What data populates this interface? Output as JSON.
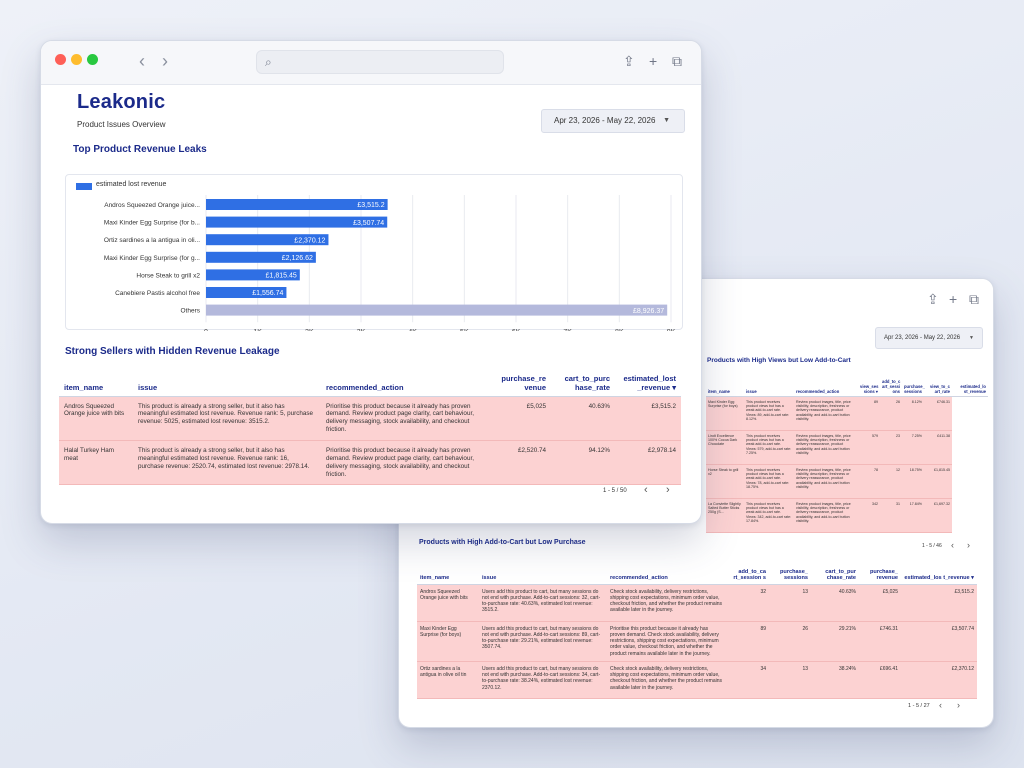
{
  "main": {
    "brand": "Leakonic",
    "subtitle": "Product Issues Overview",
    "date_range": "Apr 23, 2026 - May 22, 2026",
    "chart_title": "Top Product Revenue Leaks",
    "section2_title": "Strong Sellers with Hidden Revenue Leakage",
    "table": {
      "headers": [
        "item_name",
        "issue",
        "recommended_action",
        "purchase_re venue",
        "cart_to_purc hase_rate",
        "estimated_lost _revenue ▾"
      ],
      "rows": [
        [
          "Andros Squeezed Orange juice with bits",
          "This product is already a strong seller, but it also has meaningful estimated lost revenue. Revenue rank: 5, purchase revenue: 5025, estimated lost revenue: 3515.2.",
          "Prioritise this product because it already has proven demand. Review product page clarity, cart behaviour, delivery messaging, stock availability, and checkout friction.",
          "£5,025",
          "40.63%",
          "£3,515.2"
        ],
        [
          "Halal Turkey Ham meat",
          "This product is already a strong seller, but it also has meaningful estimated lost revenue. Revenue rank: 16, purchase revenue: 2520.74, estimated lost revenue: 2978.14.",
          "Prioritise this product because it already has proven demand. Review product page clarity, cart behaviour, delivery messaging, stock availability, and checkout friction.",
          "£2,520.74",
          "94.12%",
          "£2,978.14"
        ]
      ],
      "pager": "1 - 5 / 50"
    }
  },
  "chart_data": {
    "type": "bar",
    "orientation": "horizontal",
    "legend": "estimated lost revenue",
    "categories": [
      "Andros Squeezed Orange juice...",
      "Maxi Kinder Egg Surprise (for b...",
      "Ortiz sardines a la antigua in oli...",
      "Maxi Kinder Egg Surprise (for g...",
      "Horse Steak to grill x2",
      "Canebiere Pastis alcohol free",
      "Others"
    ],
    "values": [
      3515.2,
      3507.74,
      2370.12,
      2126.62,
      1815.45,
      1556.74,
      8926.37
    ],
    "value_labels": [
      "£3,515.2",
      "£3,507.74",
      "£2,370.12",
      "£2,126.62",
      "£1,815.45",
      "£1,556.74",
      "£8,926.37"
    ],
    "xlim": [
      0,
      9000
    ],
    "x_ticks": [
      "0",
      "1K",
      "2K",
      "3K",
      "4K",
      "5K",
      "6K",
      "7K",
      "8K",
      "9K"
    ],
    "grid": true,
    "colors": {
      "bar": "#2f6fe4",
      "others": "#b4b9dc"
    }
  },
  "second": {
    "date_range": "Apr 23, 2026 - May 22, 2026",
    "section1_title": "Products with High Views but Low Add-to-Cart",
    "table1": {
      "headers": [
        "item_name",
        "issue",
        "recommended_action",
        "view_ses sions ▾",
        "add_to_c art_sessi ons",
        "purchase_ sessions",
        "view_to_c art_rate",
        "estimated_lo st_revenue"
      ],
      "rows": [
        [
          "Maxi Kinder Egg Surprise (for boys)",
          "This product receives product views but has a weak add-to-cart rate. Views: 89, add-to-cart rate: 8.12%.",
          "Review product images, title, price visibility, description, freshness or delivery reassurance, product availability, and add-to-cart button visibility.",
          "89",
          "26",
          "8.12%",
          "£746.31"
        ],
        [
          "Lindt Excellence 100% Cocoa Dark Chocolate",
          "This product receives product views but has a weak add-to-cart rate. Views: 579, add-to-cart rate: 7.25%.",
          "Review product images, title, price visibility, description, freshness or delivery reassurance, product availability, and add-to-cart button visibility.",
          "579",
          "23",
          "7.25%",
          "£411.38"
        ],
        [
          "Horse Steak to grill x2",
          "This product receives product views but has a weak add-to-cart rate. Views: 78, add-to-cart rate: 18.75%.",
          "Review product images, title, price visibility, description, freshness or delivery reassurance, product availability, and add-to-cart button visibility.",
          "78",
          "12",
          "18.75%",
          "£1,815.45"
        ],
        [
          "La Conviette Slightly Salted Butter Sticks 250g (S...",
          "This product receives product views but has a weak add-to-cart rate. Views: 342, add-to-cart rate: 17.84%.",
          "Review product images, title, price visibility, description, freshness or delivery reassurance, product availability, and add-to-cart button visibility.",
          "342",
          "31",
          "17.84%",
          "£1,697.32"
        ]
      ],
      "pager": "1 - 5 / 46"
    },
    "section2_title": "Products with High Add-to-Cart but Low Purchase",
    "table2": {
      "headers": [
        "item_name",
        "issue",
        "recommended_action",
        "add_to_ca rt_session s",
        "purchase_ sessions",
        "cart_to_pur chase_rate",
        "purchase_ revenue",
        "estimated_los t_revenue ▾"
      ],
      "rows": [
        [
          "Andros Squeezed Orange juice with bits",
          "Users add this product to cart, but many sessions do not end with purchase. Add-to-cart sessions: 32, cart-to-purchase rate: 40.63%, estimated lost revenue: 3515.2.",
          "Check stock availability, delivery restrictions, shipping cost expectations, minimum order value, checkout friction, and whether the product remains available later in the journey.",
          "32",
          "13",
          "40.63%",
          "£5,025",
          "£3,515.2"
        ],
        [
          "Maxi Kinder Egg Surprise (for boys)",
          "Users add this product to cart, but many sessions do not end with purchase. Add-to-cart sessions: 89, cart-to-purchase rate: 29.21%, estimated lost revenue: 3507.74.",
          "Prioritise this product because it already has proven demand. Check stock availability, delivery restrictions, shipping cost expectations, minimum order value, checkout friction, and whether the product remains available later in the journey.",
          "89",
          "26",
          "29.21%",
          "£746.31",
          "£3,507.74"
        ],
        [
          "Ortiz sardines a la antigua in olive oil tin",
          "Users add this product to cart, but many sessions do not end with purchase. Add-to-cart sessions: 34, cart-to-purchase rate: 38.24%, estimated lost revenue: 2370.12.",
          "Check stock availability, delivery restrictions, shipping cost expectations, minimum order value, checkout friction, and whether the product remains available later in the journey.",
          "34",
          "13",
          "38.24%",
          "£696.41",
          "£2,370.12"
        ]
      ],
      "pager": "1 - 5 / 27"
    }
  }
}
